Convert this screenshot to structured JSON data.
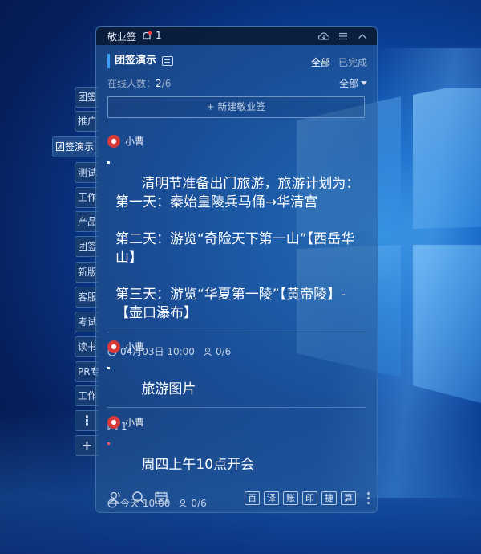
{
  "app": {
    "title": "敬业签",
    "notification_count": "1"
  },
  "side_tabs": [
    {
      "label": "团签"
    },
    {
      "label": "推广"
    },
    {
      "label": "团签演示"
    },
    {
      "label": "测试"
    },
    {
      "label": "工作"
    },
    {
      "label": "产品"
    },
    {
      "label": "团签"
    },
    {
      "label": "新版"
    },
    {
      "label": "客服"
    },
    {
      "label": "考试"
    },
    {
      "label": "读书"
    },
    {
      "label": "PR专"
    },
    {
      "label": "工作"
    },
    {
      "label": "⋮"
    },
    {
      "label": "+"
    }
  ],
  "group": {
    "name": "团签演示",
    "filter_all": "全部",
    "filter_done": "已完成",
    "online_label": "在线人数：",
    "online_current": "2",
    "online_total": "/6",
    "scope": "全部"
  },
  "new_note_button": "+ 新建敬业签",
  "notes": [
    {
      "author": "小曹",
      "content": "清明节准备出门旅游，旅游计划为：\n第一天：秦始皇陵兵马俑→华清宫\n\n第二天：游览“奇险天下第一山”【西岳华山】\n\n第三天：游览“华夏第一陵”【黄帝陵】-【壶口瀑布】",
      "time": "04月03日 10:00",
      "assignees": "0/6"
    },
    {
      "author": "小曹",
      "content": "旅游图片",
      "image_count": "1"
    },
    {
      "author": "小曹",
      "content": "周四上午10点开会",
      "time": "今天 10:00",
      "assignees": "0/6"
    }
  ],
  "toolbar": {
    "tools": [
      "百",
      "译",
      "账",
      "印",
      "捷",
      "算"
    ]
  },
  "colors": {
    "accent": "#3ca0ff",
    "avatar": "#d83a3a",
    "important_dot": "#ff5a5a"
  }
}
